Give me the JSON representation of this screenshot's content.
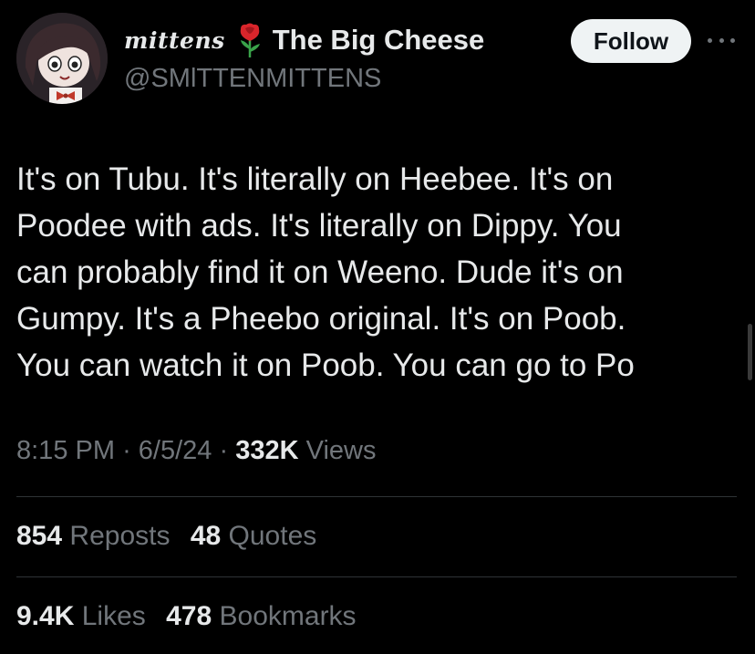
{
  "tweet": {
    "author": {
      "display_name_script": "mittens",
      "display_name_emoji": "rose-icon",
      "display_name": "The Big Cheese",
      "handle": "@SMlTTENMITTENS"
    },
    "follow_label": "Follow",
    "text": "It's on Tubu. It's literally on Heebee. It's on\nPoodee with ads. It's literally on Dippy. You\ncan probably find it on Weeno. Dude it's on\nGumpy. It's a Pheebo original. It's on Poob.\nYou can watch it on Poob. You can go to Po",
    "time": "8:15 PM",
    "separator": "·",
    "date": "6/5/24",
    "views_count": "332K",
    "views_label": "Views",
    "reposts_count": "854",
    "reposts_label": "Reposts",
    "quotes_count": "48",
    "quotes_label": "Quotes",
    "likes_count": "9.4K",
    "likes_label": "Likes",
    "bookmarks_count": "478",
    "bookmarks_label": "Bookmarks"
  },
  "colors": {
    "background": "#000000",
    "primary_text": "#e7e9ea",
    "secondary_text": "#71767b",
    "divider": "#2f3336",
    "follow_button_bg": "#eff3f4"
  }
}
